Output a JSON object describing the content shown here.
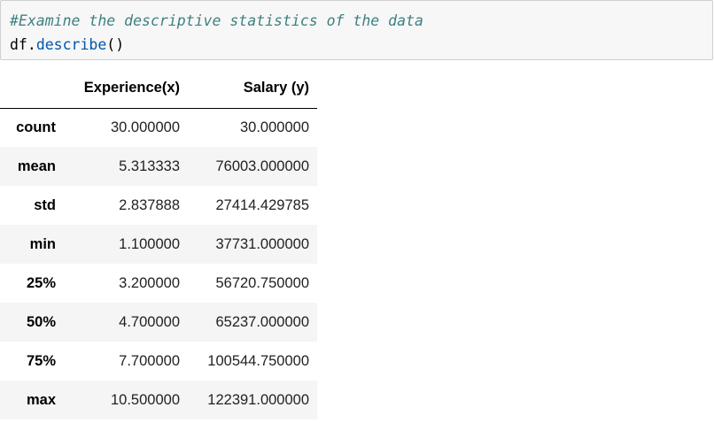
{
  "code_cell": {
    "comment": "#Examine the descriptive statistics of the data",
    "code_object": "df.",
    "code_function": "describe",
    "code_parens": "()"
  },
  "table": {
    "index_header": "",
    "columns": [
      "Experience(x)",
      "Salary (y)"
    ],
    "rows": [
      {
        "label": "count",
        "values": [
          "30.000000",
          "30.000000"
        ]
      },
      {
        "label": "mean",
        "values": [
          "5.313333",
          "76003.000000"
        ]
      },
      {
        "label": "std",
        "values": [
          "2.837888",
          "27414.429785"
        ]
      },
      {
        "label": "min",
        "values": [
          "1.100000",
          "37731.000000"
        ]
      },
      {
        "label": "25%",
        "values": [
          "3.200000",
          "56720.750000"
        ]
      },
      {
        "label": "50%",
        "values": [
          "4.700000",
          "65237.000000"
        ]
      },
      {
        "label": "75%",
        "values": [
          "7.700000",
          "100544.750000"
        ]
      },
      {
        "label": "max",
        "values": [
          "10.500000",
          "122391.000000"
        ]
      }
    ]
  },
  "colors": {
    "code_background": "#f7f7f7",
    "comment": "#408080",
    "function": "#0055aa",
    "row_stripe": "#f5f5f5"
  }
}
